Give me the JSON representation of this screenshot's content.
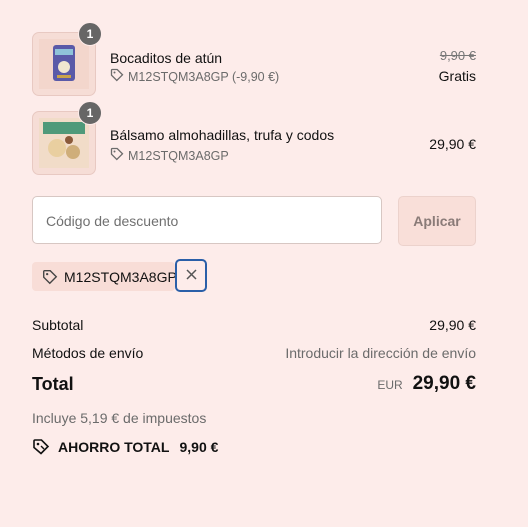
{
  "items": [
    {
      "quantity": "1",
      "name": "Bocaditos de atún",
      "code": "M12STQM3A8GP (-9,90 €)",
      "original_price": "9,90 €",
      "price": "Gratis"
    },
    {
      "quantity": "1",
      "name": "Bálsamo almohadillas, trufa y codos",
      "code": "M12STQM3A8GP",
      "price": "29,90 €"
    }
  ],
  "discount": {
    "placeholder": "Código de descuento",
    "apply_label": "Aplicar",
    "applied_code": "M12STQM3A8GP",
    "remove_symbol": "×"
  },
  "summary": {
    "subtotal_label": "Subtotal",
    "subtotal_value": "29,90 €",
    "shipping_label": "Métodos de envío",
    "shipping_value": "Introducir la dirección de envío",
    "total_label": "Total",
    "currency": "EUR",
    "total_value": "29,90 €",
    "taxes_note": "Incluye 5,19 € de impuestos",
    "savings_label": "AHORRO TOTAL",
    "savings_value": "9,90 €"
  },
  "colors": {
    "background": "#fdecea",
    "focus_ring": "#2a5fa8",
    "quantity_badge": "#666666"
  },
  "icons": [
    "tag-icon",
    "close-icon",
    "savings-tag-icon"
  ]
}
